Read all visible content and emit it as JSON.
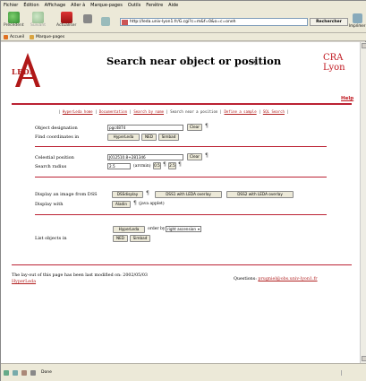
{
  "browser": {
    "menu": [
      "Fichier",
      "Édition",
      "Affichage",
      "Aller à",
      "Marque-pages",
      "Outils",
      "Fenêtre",
      "Aide"
    ],
    "back_label": "Précédent",
    "forward_label": "Suivant",
    "reload_label": "Actualiser",
    "address": "http://leda.univ-lyon1.fr/G.cgi?c=m&f=0&o=c=oneh",
    "search_label": "Rechercher",
    "print_label": "Imprimer",
    "bookmarks": [
      "Accueil",
      "Marque-pages"
    ],
    "status": "Done"
  },
  "page": {
    "logo": "LEDA",
    "title": "Search near object or position",
    "cra_line1": "CRA",
    "cra_line2": "Lyon",
    "help": "Help",
    "nav": {
      "hyperleda_home": "HyperLeda home",
      "documentation": "Documentation",
      "search_by_name": "Search by name",
      "current": "Search near a position",
      "define_sample": "Define a sample",
      "sql_search": "SQL Search"
    },
    "form": {
      "object_designation_label": "Object designation",
      "object_designation_value": "pgc4874",
      "clear_label": "Clear",
      "find_coords_label": "Find coordinates in",
      "hyperleda_btn": "HyperLeda",
      "ned_btn": "NED",
      "simbad_btn": "Simbad",
      "celestial_label": "Celestial position",
      "celestial_value": "J012510.8+281346",
      "search_radius_label": "Search radius",
      "search_radius_value": "2.5",
      "arcmin_label": "(arcmin)",
      "r05_btn": "0.5",
      "r25_btn": "2.5",
      "display_dss_label": "Display an image from DSS",
      "dss_display_btn": "DSSdisplay",
      "dss1_btn": "DSS1 with LEDA overlay",
      "dss2_btn": "DSS2 with LEDA overlay",
      "display_with_label": "Display with",
      "aladin_btn": "Aladin",
      "java_label": "(java applet)",
      "list_objects_label": "List objects in",
      "order_by_label": "order by",
      "order_value": "right ascension"
    },
    "footer": {
      "modified": "The lay-out of this page has been last modified on: 2002/05/03",
      "hyperleda_link": "HyperLeda",
      "questions_label": "Questions:",
      "email": "prugniel@obs.univ-lyon1.fr"
    }
  }
}
